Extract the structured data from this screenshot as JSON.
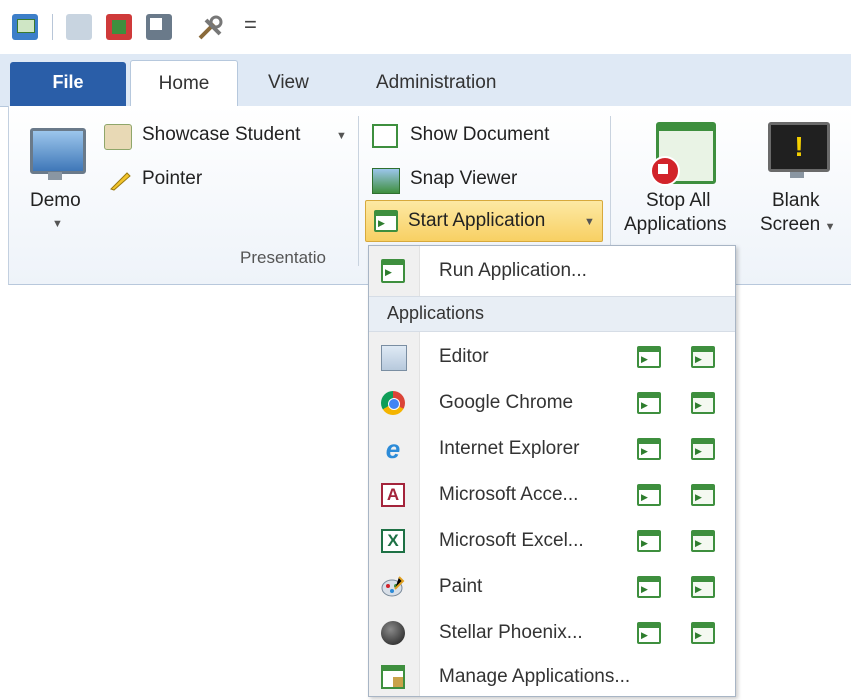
{
  "qat": {
    "icons": [
      "app-icon",
      "undo-icon",
      "refresh-icon",
      "pointer-icon",
      "tools-icon"
    ],
    "more": "="
  },
  "tabs": [
    "File",
    "Home",
    "View",
    "Administration"
  ],
  "ribbon": {
    "demo_label": "Demo",
    "showcase_label": "Showcase Student",
    "pointer_label": "Pointer",
    "show_document_label": "Show Document",
    "snap_viewer_label": "Snap Viewer",
    "start_application_label": "Start Application",
    "stop_all_line1": "Stop All",
    "stop_all_line2": "Applications",
    "blank_line1": "Blank",
    "blank_line2": "Screen",
    "group_label": "Presentatio"
  },
  "dropdown": {
    "run_label": "Run Application...",
    "section_header": "Applications",
    "apps": [
      {
        "label": "Editor",
        "icon": "notepad-icon"
      },
      {
        "label": "Google Chrome",
        "icon": "chrome-icon"
      },
      {
        "label": "Internet Explorer",
        "icon": "ie-icon"
      },
      {
        "label": "Microsoft Acce...",
        "icon": "access-icon"
      },
      {
        "label": "Microsoft Excel...",
        "icon": "excel-icon"
      },
      {
        "label": "Paint",
        "icon": "paint-icon"
      },
      {
        "label": "Stellar Phoenix...",
        "icon": "stellar-icon"
      }
    ],
    "manage_label": "Manage Applications..."
  },
  "colors": {
    "file_tab": "#2a5ea8",
    "highlight": "#f8d063",
    "ribbon_bg": "#dfe9f5"
  }
}
